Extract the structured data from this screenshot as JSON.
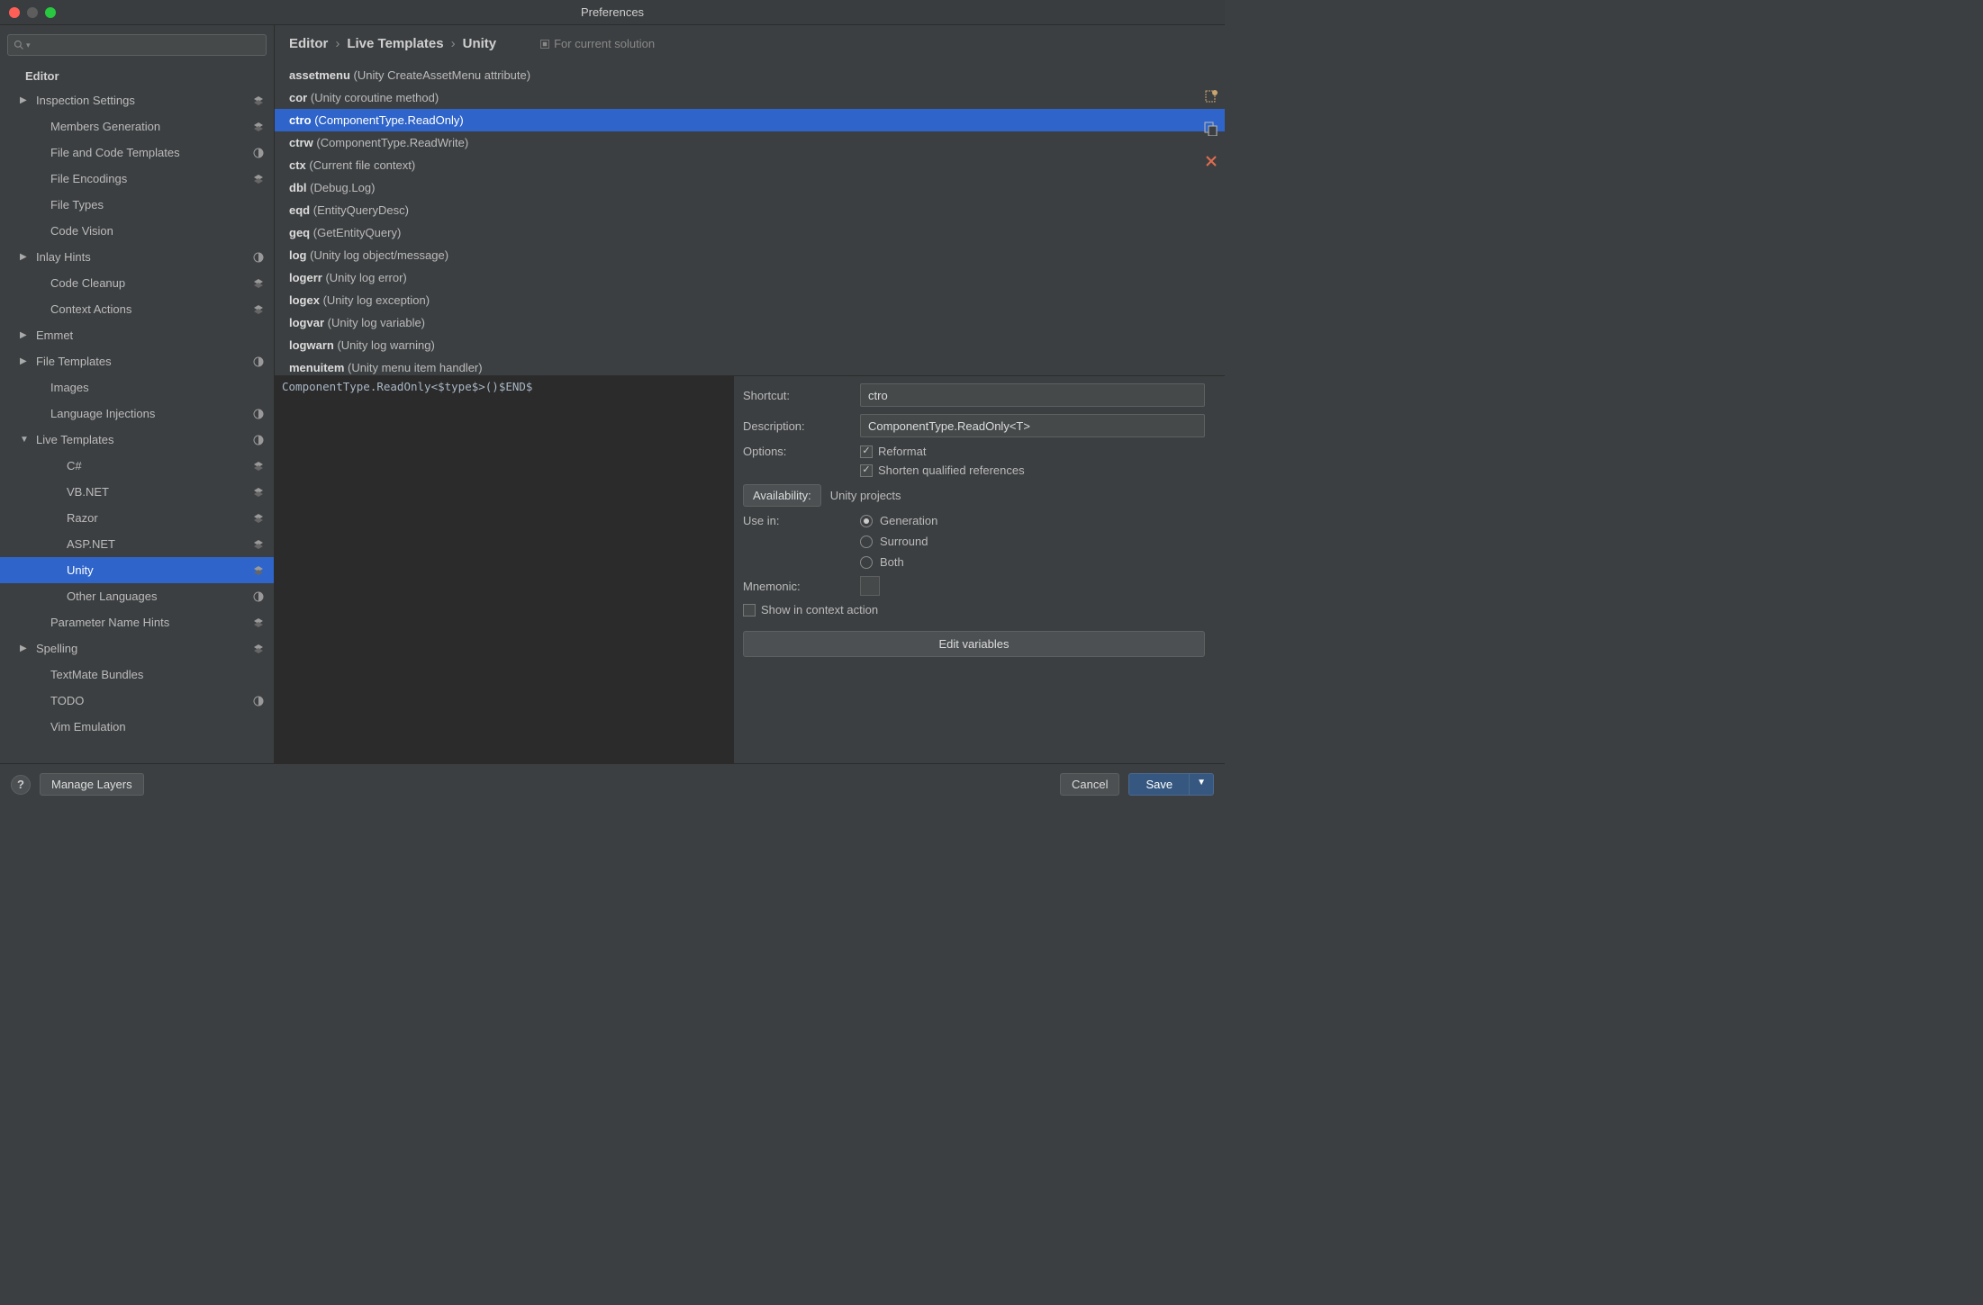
{
  "window": {
    "title": "Preferences"
  },
  "search": {
    "placeholder": ""
  },
  "sidebar": {
    "heading": "Editor",
    "items": [
      {
        "label": "Inspection Settings",
        "level": "l1",
        "arrow": "right",
        "icon": "layers"
      },
      {
        "label": "Members Generation",
        "level": "l2",
        "icon": "layers"
      },
      {
        "label": "File and Code Templates",
        "level": "l2",
        "icon": "half"
      },
      {
        "label": "File Encodings",
        "level": "l2",
        "icon": "layers"
      },
      {
        "label": "File Types",
        "level": "l2"
      },
      {
        "label": "Code Vision",
        "level": "l2"
      },
      {
        "label": "Inlay Hints",
        "level": "l1",
        "arrow": "right",
        "icon": "half"
      },
      {
        "label": "Code Cleanup",
        "level": "l2",
        "icon": "layers"
      },
      {
        "label": "Context Actions",
        "level": "l2",
        "icon": "layers"
      },
      {
        "label": "Emmet",
        "level": "l1",
        "arrow": "right"
      },
      {
        "label": "File Templates",
        "level": "l1",
        "arrow": "right",
        "icon": "half"
      },
      {
        "label": "Images",
        "level": "l2"
      },
      {
        "label": "Language Injections",
        "level": "l2",
        "icon": "half"
      },
      {
        "label": "Live Templates",
        "level": "l1",
        "arrow": "down",
        "icon": "half"
      },
      {
        "label": "C#",
        "level": "l3",
        "icon": "layers"
      },
      {
        "label": "VB.NET",
        "level": "l3",
        "icon": "layers"
      },
      {
        "label": "Razor",
        "level": "l3",
        "icon": "layers"
      },
      {
        "label": "ASP.NET",
        "level": "l3",
        "icon": "layers"
      },
      {
        "label": "Unity",
        "level": "l3",
        "icon": "layers",
        "selected": true
      },
      {
        "label": "Other Languages",
        "level": "l3",
        "icon": "half"
      },
      {
        "label": "Parameter Name Hints",
        "level": "l2",
        "icon": "layers"
      },
      {
        "label": "Spelling",
        "level": "l1",
        "arrow": "right",
        "icon": "layers"
      },
      {
        "label": "TextMate Bundles",
        "level": "l2"
      },
      {
        "label": "TODO",
        "level": "l2",
        "icon": "half"
      },
      {
        "label": "Vim Emulation",
        "level": "l2"
      }
    ]
  },
  "breadcrumb": {
    "b1": "Editor",
    "b2": "Live Templates",
    "b3": "Unity",
    "solution": "For current solution"
  },
  "templates": [
    {
      "abbr": "assetmenu",
      "desc": "Unity CreateAssetMenu attribute"
    },
    {
      "abbr": "cor",
      "desc": "Unity coroutine method"
    },
    {
      "abbr": "ctro",
      "desc": "ComponentType.ReadOnly<T>",
      "selected": true
    },
    {
      "abbr": "ctrw",
      "desc": "ComponentType.ReadWrite<T>"
    },
    {
      "abbr": "ctx",
      "desc": "Current file context"
    },
    {
      "abbr": "dbl",
      "desc": "Debug.Log"
    },
    {
      "abbr": "eqd",
      "desc": "EntityQueryDesc"
    },
    {
      "abbr": "geq",
      "desc": "GetEntityQuery"
    },
    {
      "abbr": "log",
      "desc": "Unity log object/message"
    },
    {
      "abbr": "logerr",
      "desc": "Unity log error"
    },
    {
      "abbr": "logex",
      "desc": "Unity log exception"
    },
    {
      "abbr": "logvar",
      "desc": "Unity log variable"
    },
    {
      "abbr": "logwarn",
      "desc": "Unity log warning"
    },
    {
      "abbr": "menuitem",
      "desc": "Unity menu item handler"
    }
  ],
  "code": "ComponentType.ReadOnly<$type$>()$END$",
  "props": {
    "shortcut_label": "Shortcut:",
    "shortcut_value": "ctro",
    "description_label": "Description:",
    "description_value": "ComponentType.ReadOnly<T>",
    "options_label": "Options:",
    "opt_reformat": "Reformat",
    "opt_shorten": "Shorten qualified references",
    "availability_btn": "Availability:",
    "availability_value": "Unity projects",
    "usein_label": "Use in:",
    "usein_generation": "Generation",
    "usein_surround": "Surround",
    "usein_both": "Both",
    "mnemonic_label": "Mnemonic:",
    "show_context": "Show in context action",
    "edit_vars": "Edit variables"
  },
  "footer": {
    "manage_layers": "Manage Layers",
    "cancel": "Cancel",
    "save": "Save"
  }
}
